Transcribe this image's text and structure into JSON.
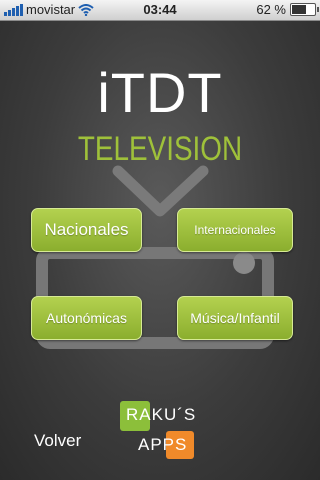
{
  "status_bar": {
    "carrier": "movistar",
    "time": "03:44",
    "battery_text": "62 %",
    "battery_level": 0.62
  },
  "app": {
    "logo": "iTDT",
    "subtitle": "TELEVISION"
  },
  "buttons": {
    "nacionales": "Nacionales",
    "internacionales": "Internacionales",
    "autonomicas": "Autonómicas",
    "musica": "Música/Infantil"
  },
  "footer": {
    "volver": "Volver",
    "brand_line1": "RAKU´S",
    "brand_line2": "APPS"
  },
  "colors": {
    "accent_green": "#9fc13a",
    "brand_orange": "#f08a2a"
  }
}
